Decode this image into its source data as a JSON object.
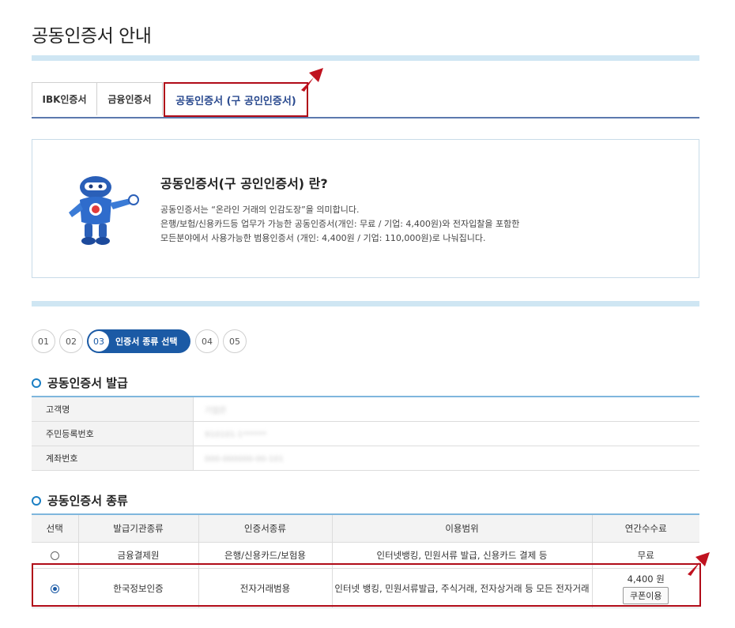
{
  "page": {
    "title": "공동인증서 안내"
  },
  "tabs": [
    {
      "label": "IBK인증서"
    },
    {
      "label": "금융인증서"
    },
    {
      "label": "공동인증서 (구 공인인증서)"
    }
  ],
  "info": {
    "title": "공동인증서(구 공인인증서) 란?",
    "lines": [
      "공동인증서는 “온라인 거래의 인감도장”을 의미합니다.",
      "은행/보험/신용카드등 업무가 가능한 공동인증서(개인: 무료 / 기업: 4,400원)와 전자입찰을 포함한",
      "모든분야에서 사용가능한 범용인증서 (개인: 4,400원 / 기업: 110,000원)로 나눠집니다."
    ]
  },
  "steps": {
    "s1": "01",
    "s2": "02",
    "s3": "03",
    "s3_label": "인증서 종류 선택",
    "s4": "04",
    "s5": "05"
  },
  "issue_section": {
    "title": "공동인증서 발급",
    "rows": [
      {
        "label": "고객명",
        "value": "기업은"
      },
      {
        "label": "주민등록번호",
        "value": "910101-1******"
      },
      {
        "label": "계좌번호",
        "value": "000-000000-00-101"
      }
    ]
  },
  "type_section": {
    "title": "공동인증서 종류",
    "headers": [
      "선택",
      "발급기관종류",
      "인증서종류",
      "이용범위",
      "연간수수료"
    ],
    "rows": [
      {
        "selected": false,
        "issuer": "금융결제원",
        "cert_type": "은행/신용카드/보험용",
        "scope": "인터넷뱅킹, 민원서류 발급, 신용카드 결제 등",
        "fee": "무료"
      },
      {
        "selected": true,
        "issuer": "한국정보인증",
        "cert_type": "전자거래범용",
        "scope": "인터넷 뱅킹, 민원서류발급, 주식거래, 전자상거래 등 모든 전자거래",
        "fee": "4,400 원",
        "button": "쿠폰이용"
      }
    ]
  },
  "colors": {
    "accent": "#1b5aa5",
    "highlight": "#b00b18",
    "bar": "#cfe6f3"
  }
}
